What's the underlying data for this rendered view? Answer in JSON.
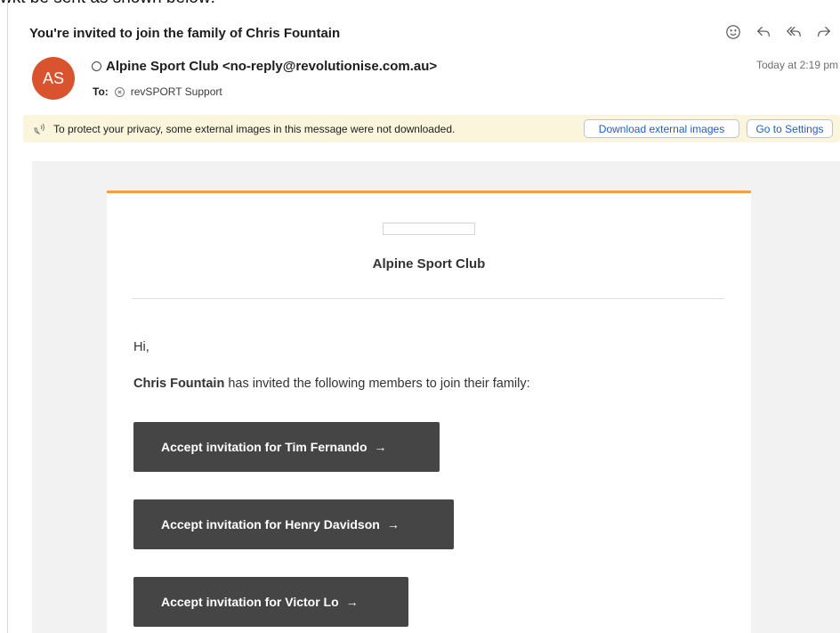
{
  "background_text": "wkt be sent as shown below:",
  "email": {
    "subject": "You're invited to join the family of Chris Fountain",
    "actions": [
      {
        "name": "emoji-reaction-icon"
      },
      {
        "name": "reply-icon"
      },
      {
        "name": "reply-all-icon"
      },
      {
        "name": "forward-icon"
      }
    ],
    "avatar_initials": "AS",
    "from": "Alpine Sport Club <no-reply@revolutionise.com.au>",
    "to_label": "To:",
    "to": "revSPORT Support",
    "timestamp": "Today at 2:19 pm"
  },
  "privacy_bar": {
    "message": "To protect your privacy, some external images in this message were not downloaded.",
    "download_label": "Download external images",
    "settings_label": "Go to Settings"
  },
  "body": {
    "club_name": "Alpine Sport Club",
    "greeting": "Hi,",
    "inviter": "Chris Fountain",
    "intro_rest": " has invited the following members to join their family:",
    "buttons": [
      {
        "label": "Accept invitation for Tim Fernando"
      },
      {
        "label": "Accept invitation for Henry Davidson"
      },
      {
        "label": "Accept invitation for Victor Lo"
      }
    ],
    "arrow": "→"
  },
  "colors": {
    "avatar": "#d9532f",
    "accent_border": "#f0a04b",
    "button_bg": "#454545",
    "privacy_bar_bg": "#fbf5dc",
    "link_blue": "#1f5fbf"
  }
}
